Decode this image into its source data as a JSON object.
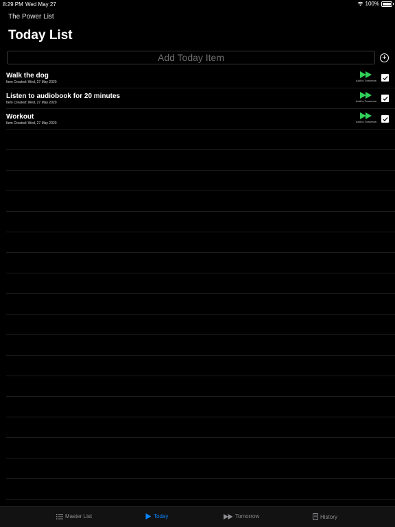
{
  "status_bar": {
    "time": "8:29 PM",
    "date": "Wed May 27",
    "battery": "100%"
  },
  "app_name": "The Power List",
  "page_title": "Today List",
  "add_input": {
    "placeholder": "Add Today Item",
    "value": ""
  },
  "items": [
    {
      "title": "Walk the dog",
      "created": "Item Created: Wed, 27 May 2020",
      "tomorrow_label": "Add to Tomorrow",
      "checked": true
    },
    {
      "title": "Listen to audiobook for 20 minutes",
      "created": "Item Created: Wed, 27 May 2020",
      "tomorrow_label": "Add to Tomorrow",
      "checked": true
    },
    {
      "title": "Workout",
      "created": "Item Created: Wed, 27 May 2020",
      "tomorrow_label": "Add to Tomorrow",
      "checked": true
    }
  ],
  "tabs": [
    {
      "label": "Master List",
      "icon": "list-icon",
      "active": false
    },
    {
      "label": "Today",
      "icon": "play-icon",
      "active": true
    },
    {
      "label": "Tomorrow",
      "icon": "fast-forward-icon",
      "active": false
    },
    {
      "label": "History",
      "icon": "book-icon",
      "active": false
    }
  ],
  "colors": {
    "accent": "#0a84ff",
    "forward_green": "#30d158",
    "background": "#000000"
  }
}
